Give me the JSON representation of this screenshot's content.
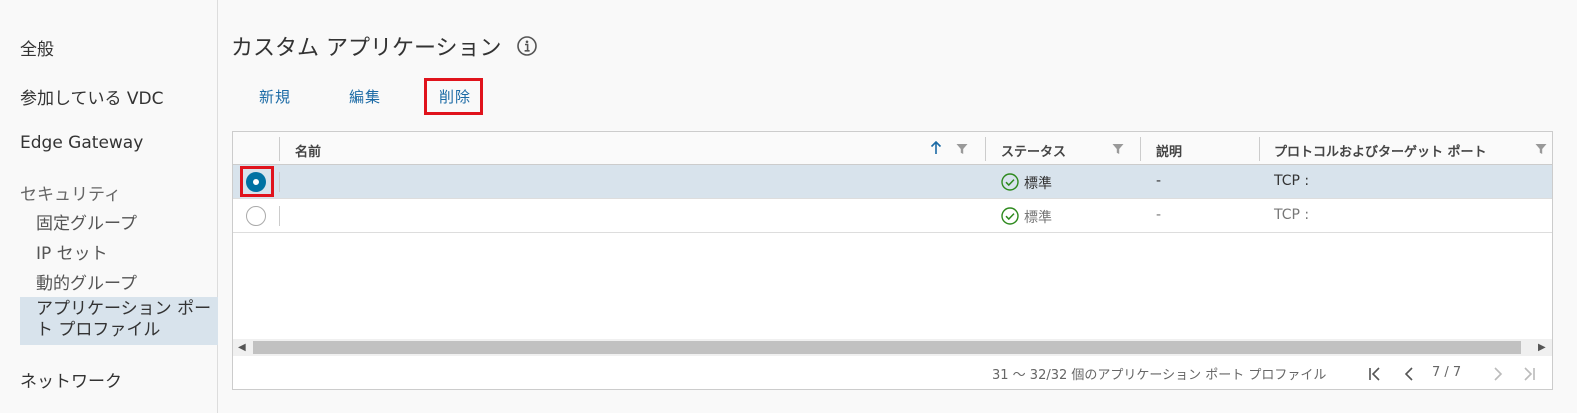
{
  "sidebar": {
    "general": "全般",
    "participating_vdc": "参加している VDC",
    "edge_gateway": "Edge Gateway",
    "security": "セキュリティ",
    "static_groups": "固定グループ",
    "ip_sets": "IP セット",
    "dynamic_groups": "動的グループ",
    "app_port_profiles": "アプリケーション ポート プロファイル",
    "network": "ネットワーク"
  },
  "page": {
    "title": "カスタム アプリケーション"
  },
  "toolbar": {
    "new_label": "新規",
    "edit_label": "編集",
    "delete_label": "削除"
  },
  "grid": {
    "columns": {
      "name": "名前",
      "status": "ステータス",
      "description": "説明",
      "protocol_ports": "プロトコルおよびターゲット ポート"
    },
    "rows": [
      {
        "name": "",
        "status": "標準",
        "description": "-",
        "protocol": "TCP :",
        "selected": true
      },
      {
        "name": "",
        "status": "標準",
        "description": "-",
        "protocol": "TCP :",
        "selected": false
      }
    ],
    "footer": "31 ～ 32/32 個のアプリケーション ポート プロファイル",
    "pagination": "7 / 7"
  },
  "colors": {
    "accent": "#1b6aa5",
    "highlight_box": "#e0131c",
    "selected_row": "#d8e3ec",
    "status_ok": "#2e8a1e"
  }
}
